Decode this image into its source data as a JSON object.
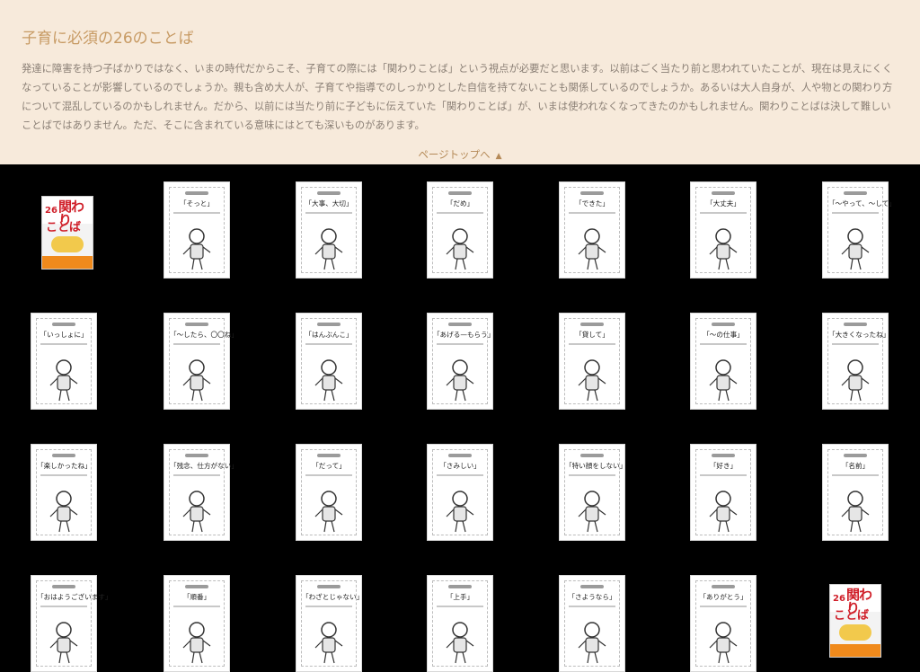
{
  "intro": {
    "title": "子育に必須の26のことば",
    "description": "発達に障害を持つ子ばかりではなく、いまの時代だからこそ、子育ての際には「関わりことば」という視点が必要だと思います。以前はごく当たり前と思われていたことが、現在は見えにくくなっていることが影響しているのでしょうか。親も含め大人が、子育てや指導でのしっかりとした自信を持てないことも関係しているのでしょうか。あるいは大人自身が、人や物との関わり方について混乱しているのかもしれません。だから、以前には当たり前に子どもに伝えていた「関わりことば」が、いまは使われなくなってきたのかもしれません。関わりことばは決して難しいことばではありません。ただ、そこに含まれている意味にはとても深いものがあります。",
    "pagetop_label": "ページトップへ",
    "pagetop_arrow": "▲"
  },
  "book_cover": {
    "series": "子どもが伸びる",
    "title": "関わり",
    "title2": "ことば",
    "number": "26"
  },
  "cards": [
    "「そっと」",
    "「大事、大切」",
    "「だめ」",
    "「できた」",
    "「大丈夫」",
    "「〜やって、〜して」",
    "「いっしょに」",
    "「〜したら、〇〇ね」",
    "「はんぶんこ」",
    "「あげる—もらう」",
    "「貸して」",
    "「〜の仕事」",
    "「大きくなったね」",
    "「楽しかったね」",
    "「残念、仕方がない」",
    "「だって」",
    "「さみしい」",
    "「特い顔をしない」",
    "「好き」",
    "「名前」",
    "「おはようございます」",
    "「順番」",
    "「わざとじゃない」",
    "「上手」",
    "「さようなら」",
    "「ありがとう」"
  ]
}
